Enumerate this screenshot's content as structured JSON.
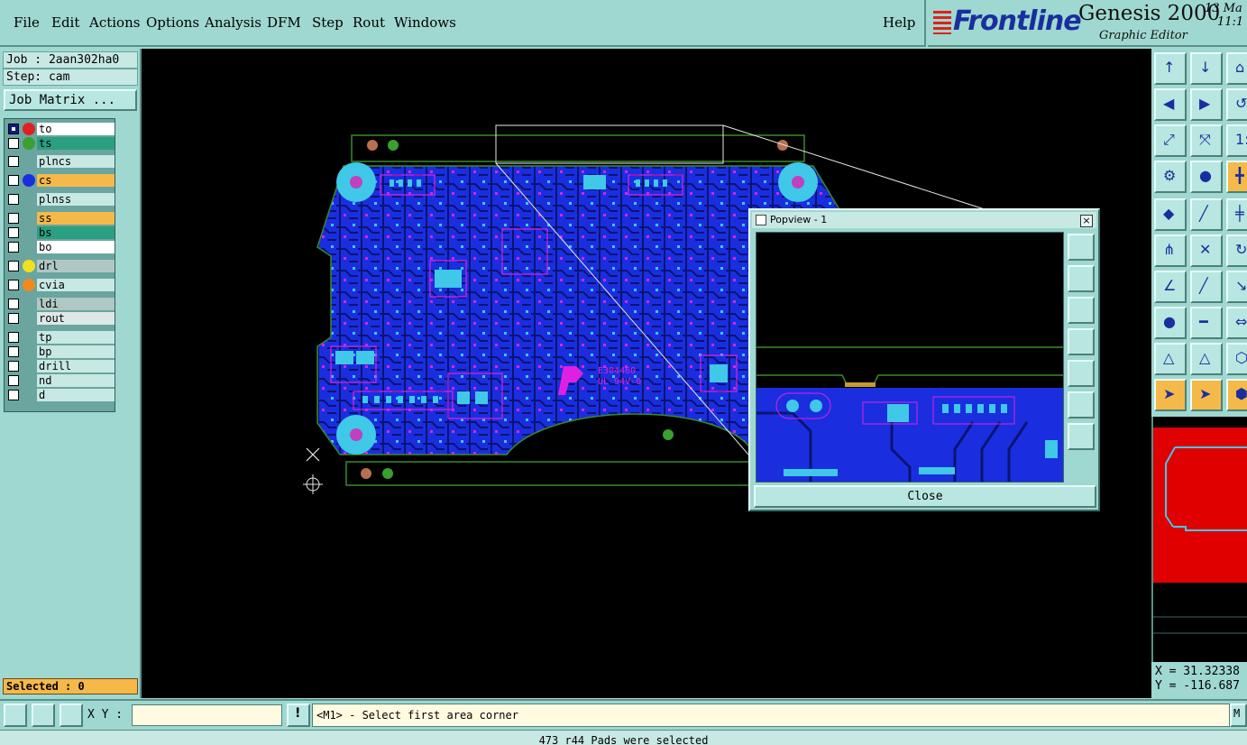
{
  "menu": {
    "items": [
      "File",
      "Edit",
      "Actions",
      "Options",
      "Analysis",
      "DFM",
      "Step",
      "Rout",
      "Windows"
    ],
    "help": "Help"
  },
  "brand": {
    "logo": "Frontline",
    "product": "Genesis 2000",
    "subtitle": "Graphic Editor",
    "date": "13 Ma",
    "time": "11:1"
  },
  "job": {
    "job_line": "Job : 2aan302ha0",
    "step_line": "Step: cam",
    "matrix_button": "Job Matrix ..."
  },
  "layers": [
    {
      "name": "to",
      "color": "#ffffff",
      "dot": "#e02020",
      "checked": true
    },
    {
      "name": "ts",
      "color": "#2aa080",
      "dot": "#3aa030",
      "checked": false
    },
    {
      "name": "plncs",
      "color": "#c8e8e4",
      "dot": "",
      "checked": false
    },
    {
      "name": "cs",
      "color": "#f5b94a",
      "dot": "#1a2ee0",
      "checked": false
    },
    {
      "name": "plnss",
      "color": "#c8e8e4",
      "dot": "",
      "checked": false
    },
    {
      "name": "ss",
      "color": "#f5b94a",
      "dot": "",
      "checked": false
    },
    {
      "name": "bs",
      "color": "#2aa080",
      "dot": "",
      "checked": false
    },
    {
      "name": "bo",
      "color": "#ffffff",
      "dot": "",
      "checked": false
    },
    {
      "name": "drl",
      "color": "#b0c8c4",
      "dot": "#f0e020",
      "checked": false
    },
    {
      "name": "cvia",
      "color": "#c8e8e4",
      "dot": "#f08a20",
      "checked": false
    },
    {
      "name": "ldi",
      "color": "#b0c8c4",
      "dot": "",
      "checked": false
    },
    {
      "name": "rout",
      "color": "#dde8e6",
      "dot": "",
      "checked": false
    },
    {
      "name": "tp",
      "color": "#c8e8e4",
      "dot": "",
      "checked": false
    },
    {
      "name": "bp",
      "color": "#c8e8e4",
      "dot": "",
      "checked": false
    },
    {
      "name": "drill",
      "color": "#c8e8e4",
      "dot": "",
      "checked": false
    },
    {
      "name": "nd",
      "color": "#c8e8e4",
      "dot": "",
      "checked": false
    },
    {
      "name": "d",
      "color": "#c8e8e4",
      "dot": "",
      "checked": false
    }
  ],
  "selected": "Selected : 0",
  "canvas": {
    "board_text_1": "E304460",
    "board_text_2": "UL 94V-0"
  },
  "popview": {
    "title": "Popview - 1",
    "close_button": "Close"
  },
  "coords": {
    "x": "X = 31.32338",
    "y": "Y = -116.687"
  },
  "bottom": {
    "xy_label": "X Y :",
    "xy_value": "",
    "prompt": "<M1> - Select first area corner",
    "status": "473 r44 Pads were selected"
  },
  "colors": {
    "panel": "#9fd8d0",
    "board": "#1a2ee0",
    "trace": "#0d1a80",
    "pad_cyan": "#3fc8e8",
    "pad_magenta": "#e020e0",
    "accent": "#f5b94a"
  }
}
